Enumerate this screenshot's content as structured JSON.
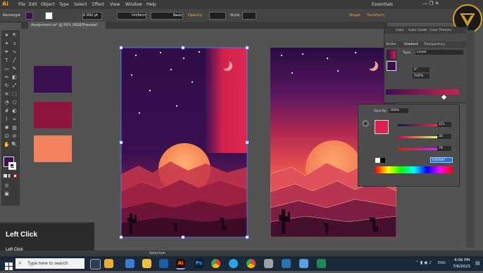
{
  "app": {
    "logo": "Ai",
    "menu": [
      "File",
      "Edit",
      "Object",
      "Type",
      "Select",
      "Effect",
      "View",
      "Window",
      "Help"
    ],
    "workspace": "Essentials"
  },
  "control_bar": {
    "tool_name": "Rectangle",
    "stroke_value": "0.992 pt",
    "stroke_profile": "Uniform",
    "brush": "Basic",
    "opacity_label": "Opacity:",
    "style_label": "Style:",
    "shape_label": "Shape",
    "transform_label": "Transform"
  },
  "document_tab": {
    "title": "Assignment.ai* @ 50% (RGB/Preview)"
  },
  "status_bar": {
    "tool": "Selection"
  },
  "swatches": {
    "colors": [
      "#3a1050",
      "#8e1540",
      "#f2825e"
    ]
  },
  "color_panel": {
    "tabs": [
      "Color",
      "Color Guide",
      "Color Themes"
    ],
    "sub_tabs": [
      "Stroke",
      "Gradient",
      "Transparency"
    ],
    "type_label": "Type:",
    "type_value": "Linear",
    "angle_value": "0°",
    "percent_value": "100%"
  },
  "gradient_popup": {
    "opacity_label": "Opacity:",
    "opacity_value": "100%",
    "values": [
      "221",
      "32",
      "79"
    ],
    "hex_value": "DD204F"
  },
  "overlay": {
    "title": "Left Click",
    "subtitle": "Left Click"
  },
  "taskbar": {
    "search_placeholder": "Type here to search",
    "time": "4:06 PM",
    "date": "7/6/2023",
    "lang": "ENG"
  },
  "colors": {
    "accent_orange": "#f4a234",
    "taskbar": "#1b2a3a"
  }
}
